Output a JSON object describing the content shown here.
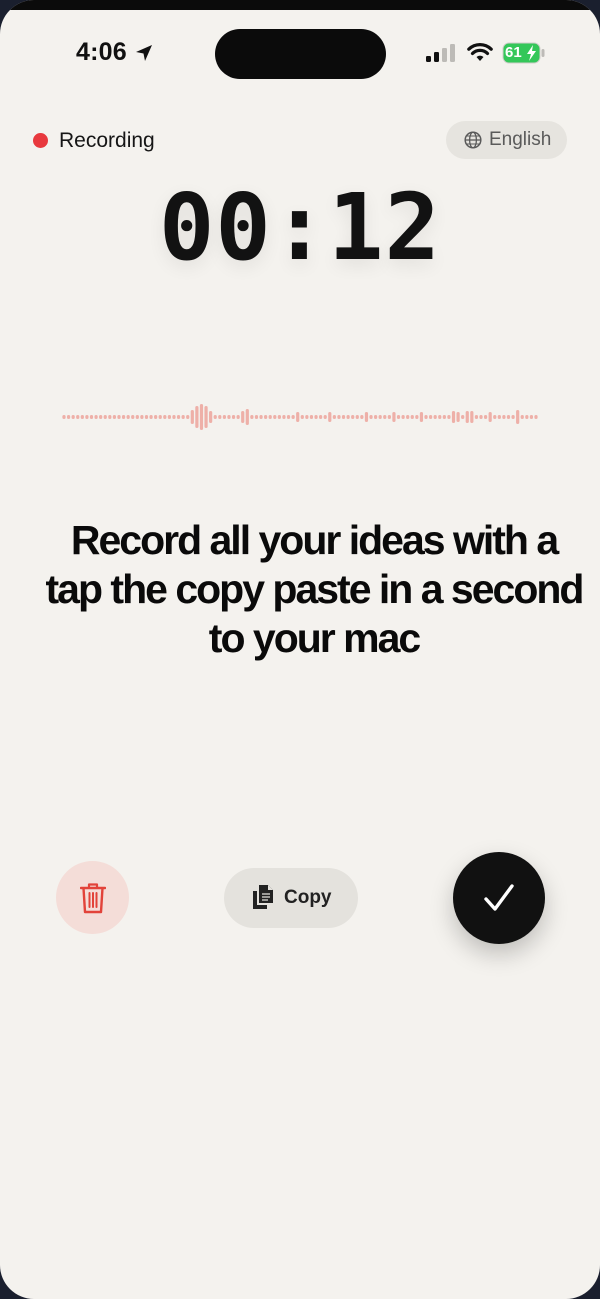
{
  "status_bar": {
    "time": "4:06",
    "battery_percent": "61",
    "icons": [
      "location-arrow-icon",
      "cellular-signal-icon",
      "wifi-icon",
      "battery-charging-icon"
    ]
  },
  "recording": {
    "label": "Recording",
    "indicator_color": "#e8393e"
  },
  "language": {
    "label": "English",
    "icon": "globe-icon"
  },
  "timer": {
    "value": "00:12"
  },
  "waveform": {
    "color": "#eeb0a8"
  },
  "headline": {
    "text": "Record all your ideas with a tap the copy paste in a second to your mac"
  },
  "controls": {
    "delete_icon": "trash-icon",
    "copy_label": "Copy",
    "copy_icon": "document-copy-icon",
    "confirm_icon": "checkmark-icon",
    "accent_delete": "#e2433a"
  }
}
